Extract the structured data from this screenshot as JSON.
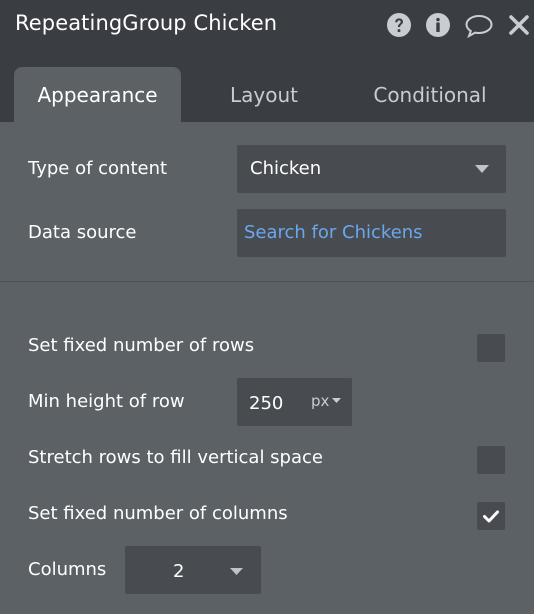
{
  "header": {
    "title": "RepeatingGroup Chicken",
    "icons": [
      "help-icon",
      "info-icon",
      "comment-icon",
      "close-icon"
    ]
  },
  "tabs": [
    {
      "label": "Appearance",
      "active": true
    },
    {
      "label": "Layout",
      "active": false
    },
    {
      "label": "Conditional",
      "active": false
    }
  ],
  "appearance": {
    "type_of_content_label": "Type of content",
    "type_of_content_value": "Chicken",
    "data_source_label": "Data source",
    "data_source_value": "Search for Chickens",
    "data_source_color": "#6aa7ee"
  },
  "rows": {
    "fixed_rows_label": "Set fixed number of rows",
    "fixed_rows_checked": false,
    "min_height_label": "Min height of row",
    "min_height_value": "250",
    "min_height_unit": "px",
    "stretch_label": "Stretch rows to fill vertical space",
    "stretch_checked": false,
    "fixed_columns_label": "Set fixed number of columns",
    "fixed_columns_checked": true,
    "columns_label": "Columns",
    "columns_value": "2"
  },
  "colors": {
    "panel": "#5c6166",
    "header": "#3a3e42",
    "field": "#484c51",
    "link": "#6aa7ee"
  }
}
